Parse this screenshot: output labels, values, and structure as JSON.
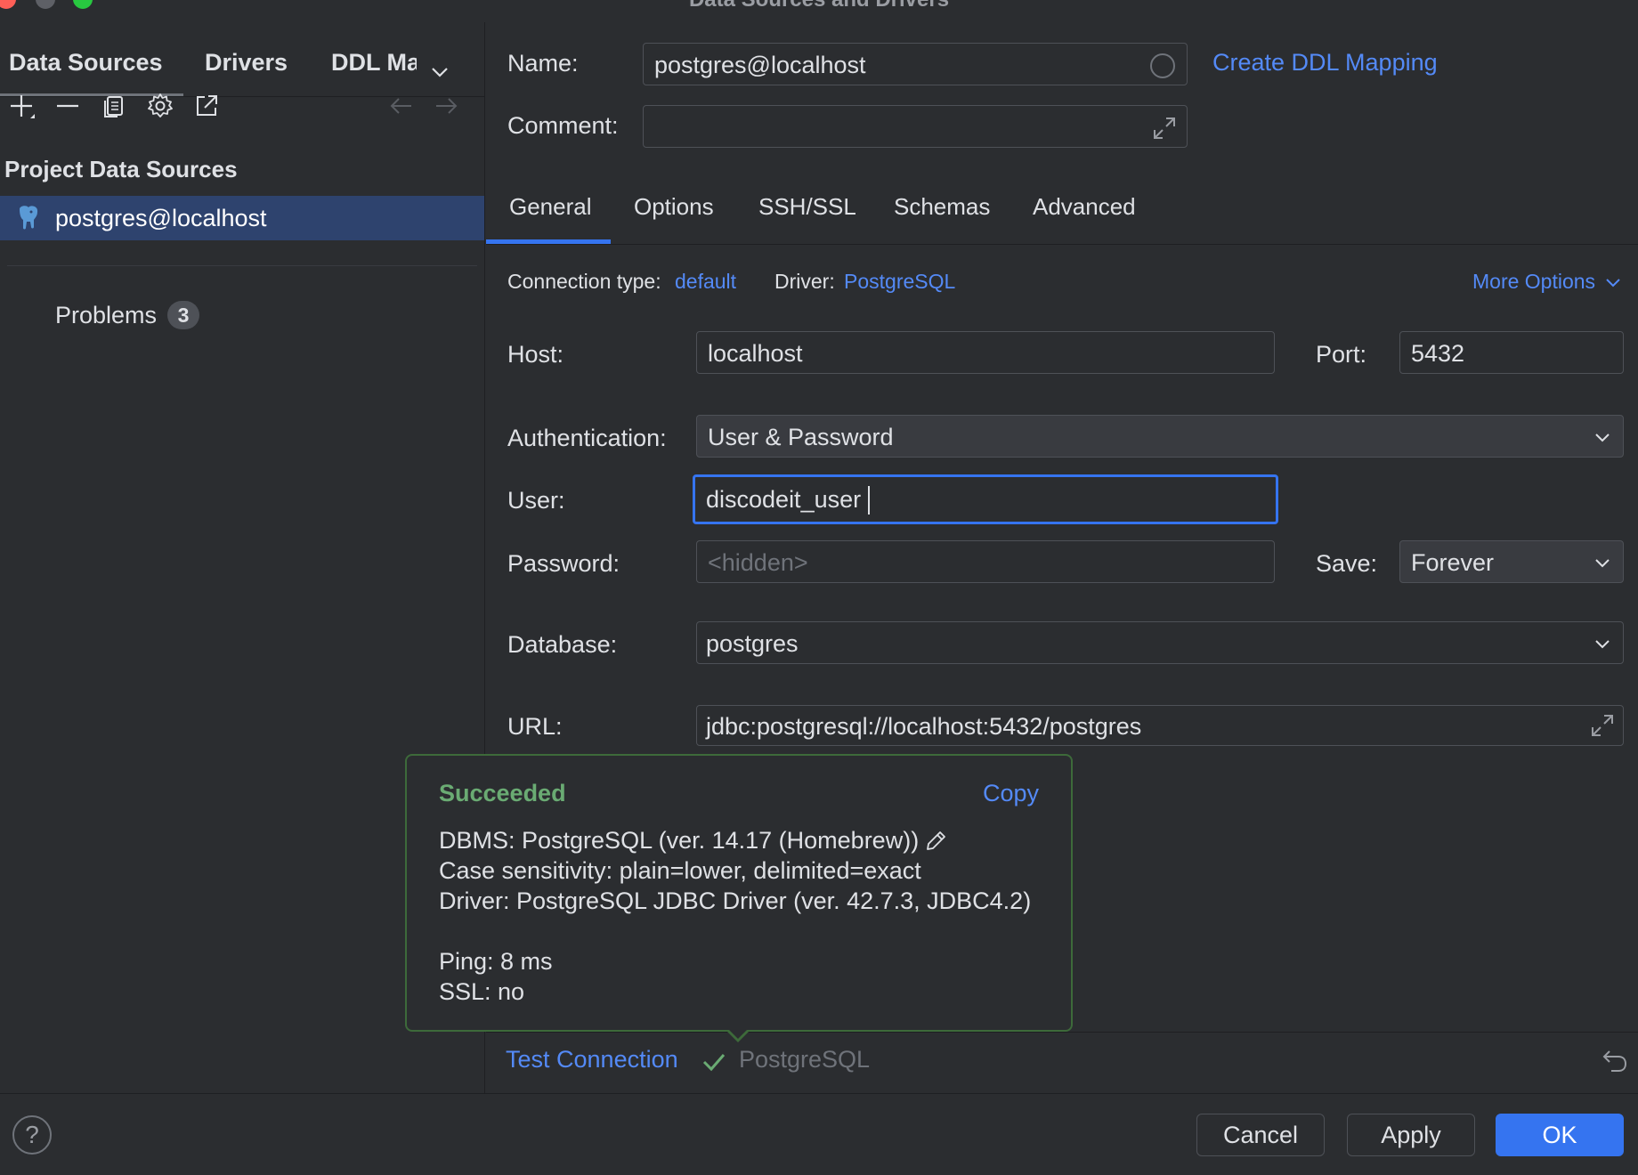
{
  "window": {
    "title": "Data Sources and Drivers",
    "traffic_colors": [
      "#ff5f57",
      "#5e6066",
      "#28c840"
    ]
  },
  "sidebar": {
    "tabs": [
      "Data Sources",
      "Drivers",
      "DDL Ma"
    ],
    "section_title": "Project Data Sources",
    "items": [
      {
        "label": "postgres@localhost",
        "icon": "postgres-elephant-icon"
      }
    ],
    "problems_label": "Problems",
    "problems_count": "3"
  },
  "form": {
    "name_label": "Name:",
    "name_value": "postgres@localhost",
    "comment_label": "Comment:",
    "create_ddl_link": "Create DDL Mapping",
    "tabs": [
      "General",
      "Options",
      "SSH/SSL",
      "Schemas",
      "Advanced"
    ],
    "active_tab": "General",
    "connection_type_label": "Connection type:",
    "connection_type_value": "default",
    "driver_label": "Driver:",
    "driver_value": "PostgreSQL",
    "more_options": "More Options",
    "host_label": "Host:",
    "host_value": "localhost",
    "port_label": "Port:",
    "port_value": "5432",
    "auth_label": "Authentication:",
    "auth_value": "User & Password",
    "user_label": "User:",
    "user_value": "discodeit_user",
    "password_label": "Password:",
    "password_placeholder": "<hidden>",
    "save_label": "Save:",
    "save_value": "Forever",
    "database_label": "Database:",
    "database_value": "postgres",
    "url_label": "URL:",
    "url_value": "jdbc:postgresql://localhost:5432/postgres"
  },
  "popup": {
    "status": "Succeeded",
    "copy": "Copy",
    "dbms": "DBMS: PostgreSQL (ver. 14.17 (Homebrew))",
    "case": "Case sensitivity: plain=lower, delimited=exact",
    "driver": "Driver: PostgreSQL JDBC Driver (ver. 42.7.3, JDBC4.2)",
    "ping": "Ping: 8 ms",
    "ssl": "SSL: no"
  },
  "test_connection": {
    "label": "Test Connection",
    "result": "PostgreSQL"
  },
  "footer": {
    "help": "?",
    "cancel": "Cancel",
    "apply": "Apply",
    "ok": "OK"
  },
  "colors": {
    "accent": "#3574f0",
    "link": "#548af7",
    "success": "#6aab73",
    "selection": "#2e436e"
  }
}
